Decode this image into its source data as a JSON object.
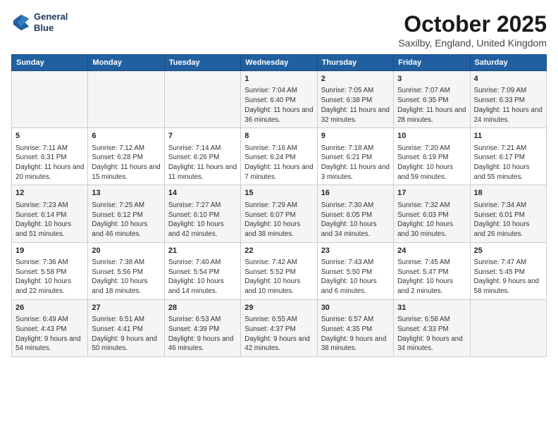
{
  "logo": {
    "line1": "General",
    "line2": "Blue"
  },
  "title": "October 2025",
  "subtitle": "Saxilby, England, United Kingdom",
  "days_of_week": [
    "Sunday",
    "Monday",
    "Tuesday",
    "Wednesday",
    "Thursday",
    "Friday",
    "Saturday"
  ],
  "weeks": [
    [
      {
        "day": "",
        "info": ""
      },
      {
        "day": "",
        "info": ""
      },
      {
        "day": "",
        "info": ""
      },
      {
        "day": "1",
        "info": "Sunrise: 7:04 AM\nSunset: 6:40 PM\nDaylight: 11 hours and 36 minutes."
      },
      {
        "day": "2",
        "info": "Sunrise: 7:05 AM\nSunset: 6:38 PM\nDaylight: 11 hours and 32 minutes."
      },
      {
        "day": "3",
        "info": "Sunrise: 7:07 AM\nSunset: 6:35 PM\nDaylight: 11 hours and 28 minutes."
      },
      {
        "day": "4",
        "info": "Sunrise: 7:09 AM\nSunset: 6:33 PM\nDaylight: 11 hours and 24 minutes."
      }
    ],
    [
      {
        "day": "5",
        "info": "Sunrise: 7:11 AM\nSunset: 6:31 PM\nDaylight: 11 hours and 20 minutes."
      },
      {
        "day": "6",
        "info": "Sunrise: 7:12 AM\nSunset: 6:28 PM\nDaylight: 11 hours and 15 minutes."
      },
      {
        "day": "7",
        "info": "Sunrise: 7:14 AM\nSunset: 6:26 PM\nDaylight: 11 hours and 11 minutes."
      },
      {
        "day": "8",
        "info": "Sunrise: 7:16 AM\nSunset: 6:24 PM\nDaylight: 11 hours and 7 minutes."
      },
      {
        "day": "9",
        "info": "Sunrise: 7:18 AM\nSunset: 6:21 PM\nDaylight: 11 hours and 3 minutes."
      },
      {
        "day": "10",
        "info": "Sunrise: 7:20 AM\nSunset: 6:19 PM\nDaylight: 10 hours and 59 minutes."
      },
      {
        "day": "11",
        "info": "Sunrise: 7:21 AM\nSunset: 6:17 PM\nDaylight: 10 hours and 55 minutes."
      }
    ],
    [
      {
        "day": "12",
        "info": "Sunrise: 7:23 AM\nSunset: 6:14 PM\nDaylight: 10 hours and 51 minutes."
      },
      {
        "day": "13",
        "info": "Sunrise: 7:25 AM\nSunset: 6:12 PM\nDaylight: 10 hours and 46 minutes."
      },
      {
        "day": "14",
        "info": "Sunrise: 7:27 AM\nSunset: 6:10 PM\nDaylight: 10 hours and 42 minutes."
      },
      {
        "day": "15",
        "info": "Sunrise: 7:29 AM\nSunset: 6:07 PM\nDaylight: 10 hours and 38 minutes."
      },
      {
        "day": "16",
        "info": "Sunrise: 7:30 AM\nSunset: 6:05 PM\nDaylight: 10 hours and 34 minutes."
      },
      {
        "day": "17",
        "info": "Sunrise: 7:32 AM\nSunset: 6:03 PM\nDaylight: 10 hours and 30 minutes."
      },
      {
        "day": "18",
        "info": "Sunrise: 7:34 AM\nSunset: 6:01 PM\nDaylight: 10 hours and 26 minutes."
      }
    ],
    [
      {
        "day": "19",
        "info": "Sunrise: 7:36 AM\nSunset: 5:58 PM\nDaylight: 10 hours and 22 minutes."
      },
      {
        "day": "20",
        "info": "Sunrise: 7:38 AM\nSunset: 5:56 PM\nDaylight: 10 hours and 18 minutes."
      },
      {
        "day": "21",
        "info": "Sunrise: 7:40 AM\nSunset: 5:54 PM\nDaylight: 10 hours and 14 minutes."
      },
      {
        "day": "22",
        "info": "Sunrise: 7:42 AM\nSunset: 5:52 PM\nDaylight: 10 hours and 10 minutes."
      },
      {
        "day": "23",
        "info": "Sunrise: 7:43 AM\nSunset: 5:50 PM\nDaylight: 10 hours and 6 minutes."
      },
      {
        "day": "24",
        "info": "Sunrise: 7:45 AM\nSunset: 5:47 PM\nDaylight: 10 hours and 2 minutes."
      },
      {
        "day": "25",
        "info": "Sunrise: 7:47 AM\nSunset: 5:45 PM\nDaylight: 9 hours and 58 minutes."
      }
    ],
    [
      {
        "day": "26",
        "info": "Sunrise: 6:49 AM\nSunset: 4:43 PM\nDaylight: 9 hours and 54 minutes."
      },
      {
        "day": "27",
        "info": "Sunrise: 6:51 AM\nSunset: 4:41 PM\nDaylight: 9 hours and 50 minutes."
      },
      {
        "day": "28",
        "info": "Sunrise: 6:53 AM\nSunset: 4:39 PM\nDaylight: 9 hours and 46 minutes."
      },
      {
        "day": "29",
        "info": "Sunrise: 6:55 AM\nSunset: 4:37 PM\nDaylight: 9 hours and 42 minutes."
      },
      {
        "day": "30",
        "info": "Sunrise: 6:57 AM\nSunset: 4:35 PM\nDaylight: 9 hours and 38 minutes."
      },
      {
        "day": "31",
        "info": "Sunrise: 6:58 AM\nSunset: 4:33 PM\nDaylight: 9 hours and 34 minutes."
      },
      {
        "day": "",
        "info": ""
      }
    ]
  ]
}
